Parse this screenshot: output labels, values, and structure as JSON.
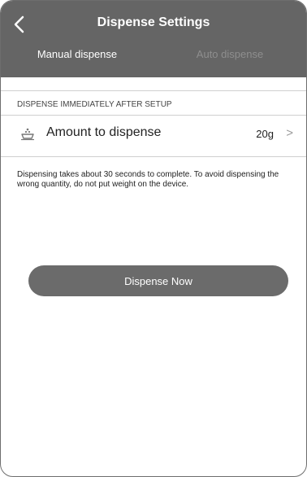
{
  "header": {
    "title": "Dispense Settings",
    "back_icon": "chevron-left-icon"
  },
  "tabs": [
    {
      "label": "Manual dispense",
      "active": true
    },
    {
      "label": "Auto dispense",
      "active": false
    }
  ],
  "section": {
    "label": "DISPENSE IMMEDIATELY AFTER SETUP"
  },
  "amount_row": {
    "icon": "food-bowl-icon",
    "label": "Amount to dispense",
    "value": "20g",
    "chevron": ">"
  },
  "note": "Dispensing takes about 30 seconds to complete. To avoid dispensing the wrong quantity, do not put weight on the device.",
  "action": {
    "label": "Dispense Now"
  },
  "colors": {
    "header_bg": "#656565",
    "button_bg": "#6b6b6b",
    "inactive_tab": "#8e8e8e"
  }
}
